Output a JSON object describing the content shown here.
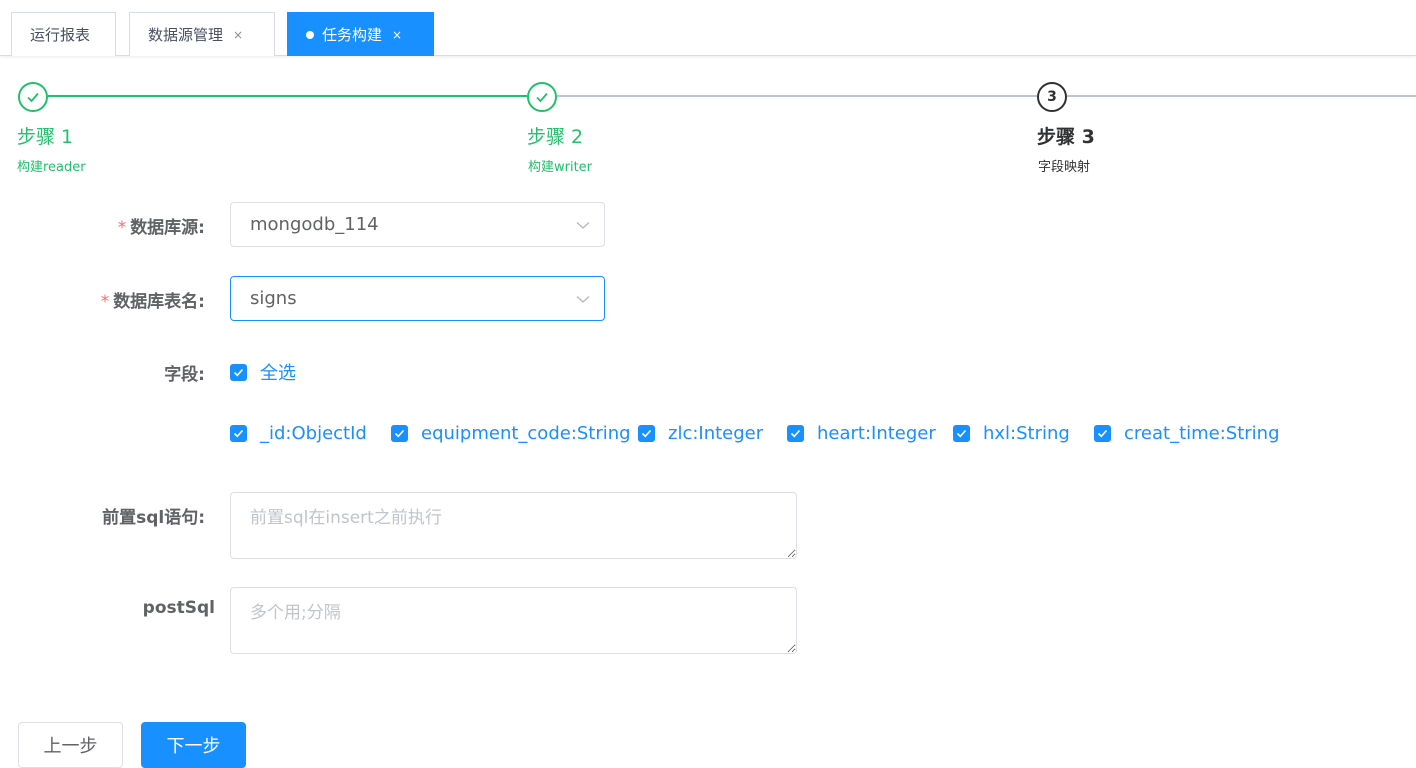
{
  "tabs": [
    {
      "label": "运行报表",
      "closable": false,
      "active": false
    },
    {
      "label": "数据源管理",
      "closable": true,
      "active": false
    },
    {
      "label": "任务构建",
      "closable": true,
      "active": true
    }
  ],
  "tab_close_glyph": "×",
  "steps": [
    {
      "title": "步骤 1",
      "description": "构建reader",
      "status": "done"
    },
    {
      "title": "步骤 2",
      "description": "构建writer",
      "status": "done"
    },
    {
      "title": "步骤 3",
      "description": "字段映射",
      "status": "current",
      "number": "3"
    }
  ],
  "form": {
    "datasource": {
      "label": "数据库源:",
      "required": true,
      "value": "mongodb_114"
    },
    "table": {
      "label": "数据库表名:",
      "required": true,
      "value": "signs"
    },
    "fields": {
      "label": "字段:",
      "select_all": {
        "label": "全选",
        "checked": true
      },
      "items": [
        {
          "label": "_id:ObjectId",
          "checked": true
        },
        {
          "label": "equipment_code:String",
          "checked": true
        },
        {
          "label": "zlc:Integer",
          "checked": true
        },
        {
          "label": "heart:Integer",
          "checked": true
        },
        {
          "label": "hxl:String",
          "checked": true
        },
        {
          "label": "creat_time:String",
          "checked": true
        }
      ]
    },
    "pre_sql": {
      "label": "前置sql语句:",
      "value": "",
      "placeholder": "前置sql在insert之前执行"
    },
    "post_sql": {
      "label": "postSql",
      "value": "",
      "placeholder": "多个用;分隔"
    }
  },
  "required_mark": "*",
  "buttons": {
    "prev": "上一步",
    "next": "下一步"
  },
  "colors": {
    "primary": "#1890ff",
    "success": "#1fc26b",
    "required": "#f56c6c",
    "text": "#303133",
    "label": "#606266",
    "border": "#dcdfe6",
    "placeholder": "#c0c4cc"
  }
}
